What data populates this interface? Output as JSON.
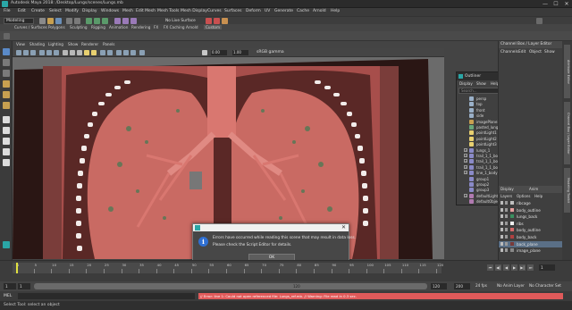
{
  "window": {
    "title": "Autodesk Maya 2018: /Desktop/Lungs/scenes/Lungs.mb",
    "min": "—",
    "max": "☐",
    "close": "✕"
  },
  "menubar": [
    "File",
    "Edit",
    "Create",
    "Select",
    "Modify",
    "Display",
    "Windows",
    "Mesh",
    "Edit Mesh",
    "Mesh Tools",
    "Mesh Display",
    "Curves",
    "Surfaces",
    "Deform",
    "UV",
    "Generate",
    "Cache",
    "Arnold",
    "Help"
  ],
  "statusline": {
    "mode": "Modeling",
    "live_surface": "No Live Surface",
    "icons": [
      "menu-set-icon",
      "new-scene-icon",
      "open-scene-icon",
      "save-scene-icon",
      "undo-icon",
      "redo-icon",
      "select-hierarchy-icon",
      "snap-grid-icon",
      "snap-curve-icon",
      "snap-point-icon",
      "render-icon",
      "ipr-icon"
    ]
  },
  "shelf": {
    "tabs": [
      "Curves / Surfaces",
      "Polygons",
      "Sculpting",
      "Rigging",
      "Animation",
      "Rendering",
      "FX",
      "FX Caching",
      "Arnold",
      "Custom"
    ],
    "active_tab": "Custom"
  },
  "viewport": {
    "menu": [
      "View",
      "Shading",
      "Lighting",
      "Show",
      "Renderer",
      "Panels"
    ],
    "field1": "0.00",
    "field2": "1.00",
    "color_space": "sRGB gamma",
    "camera_label": "persp"
  },
  "channel_box": {
    "header": "Channel Box / Layer Editor",
    "menu": [
      "Channels",
      "Edit",
      "Object",
      "Show"
    ],
    "layer_tabs": [
      "Display",
      "Anim"
    ],
    "layer_menu": [
      "Layers",
      "Options",
      "Help"
    ],
    "layers": [
      {
        "name": "ribcage",
        "color": "#c0c0c0",
        "selected": false
      },
      {
        "name": "body_outline",
        "color": "#e8a0a0",
        "selected": false
      },
      {
        "name": "lungs_back",
        "color": "#3a8f5f",
        "selected": false
      },
      {
        "name": "ribs",
        "color": "#f0f0f0",
        "selected": false
      },
      {
        "name": "body_outline",
        "color": "#d46a6a",
        "selected": false
      },
      {
        "name": "body_back",
        "color": "#b04040",
        "selected": false
      },
      {
        "name": "back_plane",
        "color": "#7a3a3a",
        "selected": true
      },
      {
        "name": "image_plane",
        "color": "#888888",
        "selected": false
      }
    ]
  },
  "side_tabs": [
    "Attribute Editor",
    "Channel Box / Layer Editor",
    "Modeling Toolkit"
  ],
  "outliner": {
    "title": "Outliner",
    "menu": [
      "Display",
      "Show",
      "Help"
    ],
    "search_placeholder": "Search...",
    "items": [
      {
        "name": "persp",
        "icon": "camera-icon",
        "expandable": false
      },
      {
        "name": "top",
        "icon": "camera-icon",
        "expandable": false
      },
      {
        "name": "front",
        "icon": "camera-icon",
        "expandable": false
      },
      {
        "name": "side",
        "icon": "camera-icon",
        "expandable": false
      },
      {
        "name": "imagePlane1",
        "icon": "image-plane-icon",
        "expandable": false
      },
      {
        "name": "pasted_lungs",
        "icon": "mesh-icon",
        "expandable": false
      },
      {
        "name": "pointLight1",
        "icon": "light-icon",
        "expandable": false
      },
      {
        "name": "pointLight2",
        "icon": "light-icon",
        "expandable": false
      },
      {
        "name": "pointLight3",
        "icon": "light-icon",
        "expandable": false
      },
      {
        "name": "lungs_1",
        "icon": "group-icon",
        "expandable": true
      },
      {
        "name": "trail_1_1_body",
        "icon": "group-icon",
        "expandable": true
      },
      {
        "name": "trail_1_1_body",
        "icon": "group-icon",
        "expandable": true
      },
      {
        "name": "trail_1_1_body",
        "icon": "group-icon",
        "expandable": true
      },
      {
        "name": "line_1_body",
        "icon": "group-icon",
        "expandable": true
      },
      {
        "name": "group1",
        "icon": "group-icon",
        "expandable": false
      },
      {
        "name": "group2",
        "icon": "group-icon",
        "expandable": false
      },
      {
        "name": "group3",
        "icon": "group-icon",
        "expandable": false
      },
      {
        "name": "defaultLightSet",
        "icon": "set-icon",
        "expandable": true
      },
      {
        "name": "defaultObjectSet",
        "icon": "set-icon",
        "expandable": false
      }
    ]
  },
  "dialog": {
    "message_line1": "Errors have occurred while reading this scene that may result in data loss.",
    "message_line2": "Please check the Script Editor for details.",
    "ok_label": "OK",
    "close": "✕"
  },
  "time_slider": {
    "ticks": [
      "1",
      "5",
      "10",
      "15",
      "20",
      "25",
      "30",
      "35",
      "40",
      "45",
      "50",
      "55",
      "60",
      "65",
      "70",
      "75",
      "80",
      "85",
      "90",
      "95",
      "100",
      "105",
      "110",
      "115",
      "120"
    ],
    "current_frame": "1",
    "playback": [
      "⏮",
      "◀|",
      "◀",
      "▶",
      "▶|",
      "⏭"
    ]
  },
  "range_slider": {
    "start": "1",
    "playback_start": "1",
    "range_end_label": "120",
    "playback_end": "120",
    "animation_end": "200",
    "fps": "24 fps",
    "anim_layer": "No Anim Layer",
    "char_set": "No Character Set"
  },
  "command_line": {
    "label": "MEL",
    "result": "// Error: line 1: Could not open referenced file: Lungs_ref.mb. // Warning: File read in 0.3 sec."
  },
  "help_line": {
    "text": "Select Tool: select an object"
  }
}
